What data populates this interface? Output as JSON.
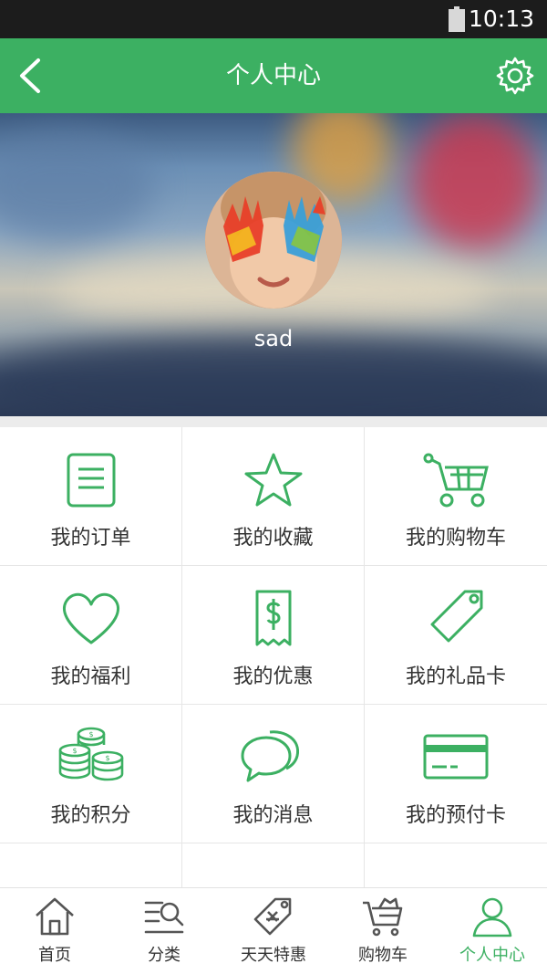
{
  "status_bar": {
    "time": "10:13"
  },
  "header": {
    "title": "个人中心"
  },
  "profile": {
    "username": "sad"
  },
  "menu": [
    {
      "label": "我的订单",
      "icon": "order-list-icon"
    },
    {
      "label": "我的收藏",
      "icon": "star-icon"
    },
    {
      "label": "我的购物车",
      "icon": "cart-icon"
    },
    {
      "label": "我的福利",
      "icon": "heart-icon"
    },
    {
      "label": "我的优惠",
      "icon": "coupon-receipt-icon"
    },
    {
      "label": "我的礼品卡",
      "icon": "tag-icon"
    },
    {
      "label": "我的积分",
      "icon": "coins-icon"
    },
    {
      "label": "我的消息",
      "icon": "chat-bubbles-icon"
    },
    {
      "label": "我的预付卡",
      "icon": "credit-card-icon"
    }
  ],
  "tabs": [
    {
      "label": "首页",
      "icon": "home-icon"
    },
    {
      "label": "分类",
      "icon": "category-search-icon"
    },
    {
      "label": "天天特惠",
      "icon": "price-tag-icon"
    },
    {
      "label": "购物车",
      "icon": "shopping-cart-icon"
    },
    {
      "label": "个人中心",
      "icon": "user-icon",
      "active": true
    }
  ],
  "colors": {
    "primary": "#3cb062",
    "status_bar": "#1c1c1c",
    "text": "#333333",
    "icon_green": "#3cb062"
  }
}
